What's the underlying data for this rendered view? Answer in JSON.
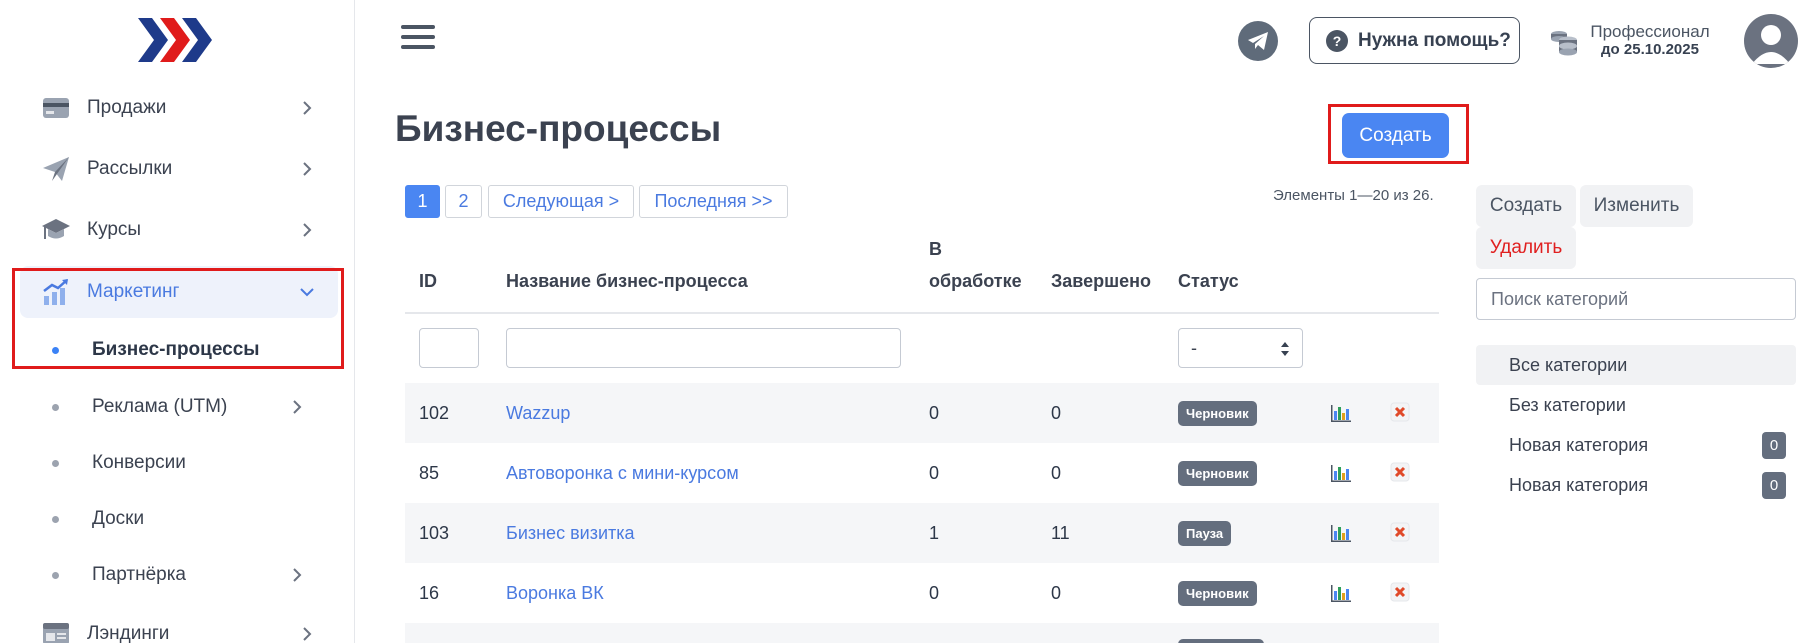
{
  "sidebar": {
    "items": [
      {
        "label": "Продажи"
      },
      {
        "label": "Рассылки"
      },
      {
        "label": "Курсы"
      },
      {
        "label": "Маркетинг"
      },
      {
        "label": "Лэндинги"
      }
    ],
    "submenu": [
      {
        "label": "Бизнес-процессы"
      },
      {
        "label": "Реклама (UTM)"
      },
      {
        "label": "Конверсии"
      },
      {
        "label": "Доски"
      },
      {
        "label": "Партнёрка"
      }
    ]
  },
  "header": {
    "help_label": "Нужна помощь?",
    "help_icon_text": "?",
    "plan_name": "Профессионал",
    "plan_date": "до 25.10.2025"
  },
  "main": {
    "title": "Бизнес-процессы",
    "create_label": "Создать",
    "pagination": {
      "pages": [
        "1",
        "2"
      ],
      "next": "Следующая >",
      "last": "Последняя >>"
    },
    "elements_count": "Элементы 1—20 из 26.",
    "columns": {
      "id": "ID",
      "name": "Название бизнес-процесса",
      "processing_1": "В",
      "processing_2": "обработке",
      "done": "Завершено",
      "status": "Статус"
    },
    "status_filter_value": "-",
    "rows": [
      {
        "id": "102",
        "name": "Wazzup",
        "processing": "0",
        "done": "0",
        "status": "Черновик"
      },
      {
        "id": "85",
        "name": "Автоворонка с мини-курсом",
        "processing": "0",
        "done": "0",
        "status": "Черновик"
      },
      {
        "id": "103",
        "name": "Бизнес визитка",
        "processing": "1",
        "done": "11",
        "status": "Пауза"
      },
      {
        "id": "16",
        "name": "Воронка ВК",
        "processing": "0",
        "done": "0",
        "status": "Черновик"
      }
    ]
  },
  "categories": {
    "create_label": "Создать",
    "edit_label": "Изменить",
    "delete_label": "Удалить",
    "search_placeholder": "Поиск категорий",
    "items": [
      {
        "label": "Все категории"
      },
      {
        "label": "Без категории"
      },
      {
        "label": "Новая категория",
        "count": "0"
      },
      {
        "label": "Новая категория",
        "count": "0"
      }
    ]
  },
  "colors": {
    "accent": "#4a86f2",
    "highlight": "#e01b1b",
    "badge": "#646e7e"
  }
}
